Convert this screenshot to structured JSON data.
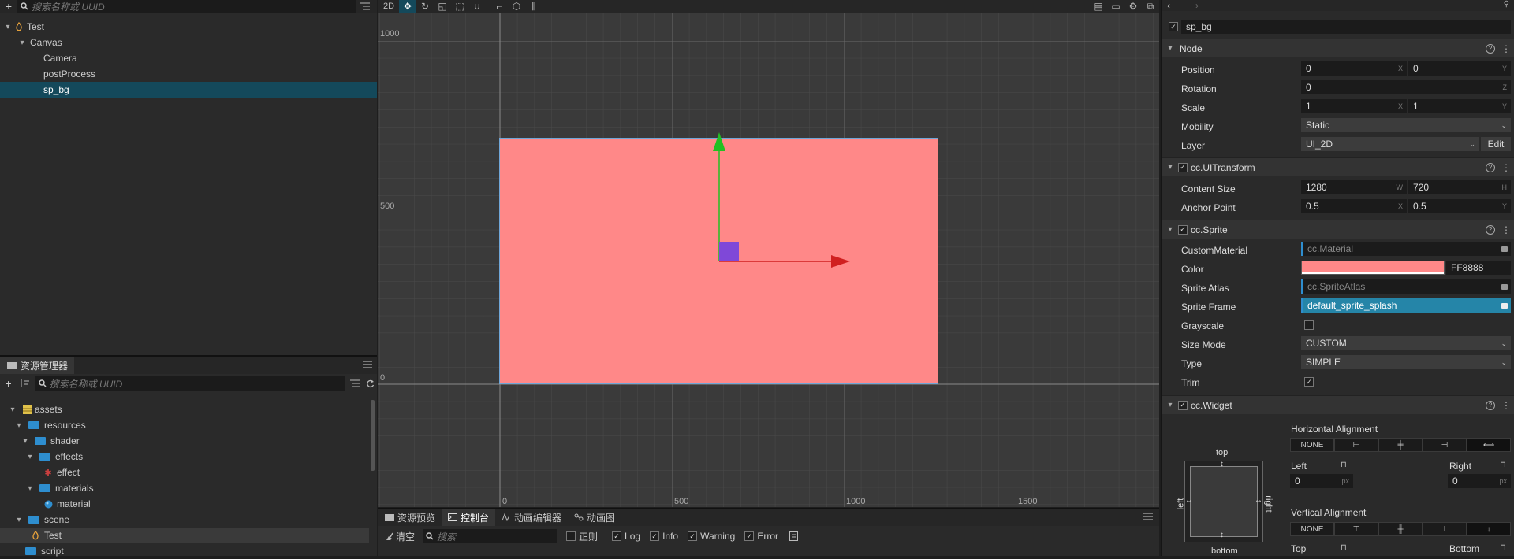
{
  "hierarchy": {
    "search_placeholder": "搜索名称或 UUID",
    "nodes": [
      {
        "label": "Test"
      },
      {
        "label": "Canvas"
      },
      {
        "label": "Camera"
      },
      {
        "label": "postProcess"
      },
      {
        "label": "sp_bg"
      }
    ]
  },
  "assets": {
    "tab_label": "资源管理器",
    "search_placeholder": "搜索名称或 UUID",
    "items": [
      {
        "label": "assets"
      },
      {
        "label": "resources"
      },
      {
        "label": "shader"
      },
      {
        "label": "effects"
      },
      {
        "label": "effect"
      },
      {
        "label": "materials"
      },
      {
        "label": "material"
      },
      {
        "label": "scene"
      },
      {
        "label": "Test"
      },
      {
        "label": "script"
      }
    ]
  },
  "scene": {
    "mode_label": "2D",
    "grid_labels_y": [
      "1000",
      "500",
      "0"
    ],
    "grid_labels_x": [
      "0",
      "500",
      "1000",
      "1500"
    ],
    "sprite_color": "#FF8888"
  },
  "console": {
    "tabs": [
      "资源预览",
      "控制台",
      "动画编辑器",
      "动画图"
    ],
    "clear_label": "清空",
    "search_placeholder": "搜索",
    "regex_label": "正则",
    "filters": [
      "Log",
      "Info",
      "Warning",
      "Error"
    ]
  },
  "inspector": {
    "node_name": "sp_bg",
    "node_section": "Node",
    "position_label": "Position",
    "position_x": "0",
    "position_y": "0",
    "rotation_label": "Rotation",
    "rotation_z": "0",
    "scale_label": "Scale",
    "scale_x": "1",
    "scale_y": "1",
    "mobility_label": "Mobility",
    "mobility_value": "Static",
    "layer_label": "Layer",
    "layer_value": "UI_2D",
    "edit_label": "Edit",
    "uitransform_section": "cc.UITransform",
    "content_size_label": "Content Size",
    "content_w": "1280",
    "content_h": "720",
    "anchor_label": "Anchor Point",
    "anchor_x": "0.5",
    "anchor_y": "0.5",
    "sprite_section": "cc.Sprite",
    "custom_material_label": "CustomMaterial",
    "custom_material_value": "cc.Material",
    "color_label": "Color",
    "color_hex": "FF8888",
    "color_value": "#FF8888",
    "sprite_atlas_label": "Sprite Atlas",
    "sprite_atlas_value": "cc.SpriteAtlas",
    "sprite_frame_label": "Sprite Frame",
    "sprite_frame_value": "default_sprite_splash",
    "grayscale_label": "Grayscale",
    "size_mode_label": "Size Mode",
    "size_mode_value": "CUSTOM",
    "type_label": "Type",
    "type_value": "SIMPLE",
    "trim_label": "Trim",
    "widget_section": "cc.Widget",
    "h_align_label": "Horizontal Alignment",
    "none_label": "NONE",
    "left_label": "Left",
    "left_value": "0",
    "right_label": "Right",
    "right_value": "0",
    "px_unit": "px",
    "v_align_label": "Vertical Alignment",
    "v_none_label": "NONE",
    "top_label": "Top",
    "bottom_label": "Bottom",
    "box_top": "top",
    "box_bottom": "bottom",
    "box_left": "left",
    "box_right": "right"
  }
}
